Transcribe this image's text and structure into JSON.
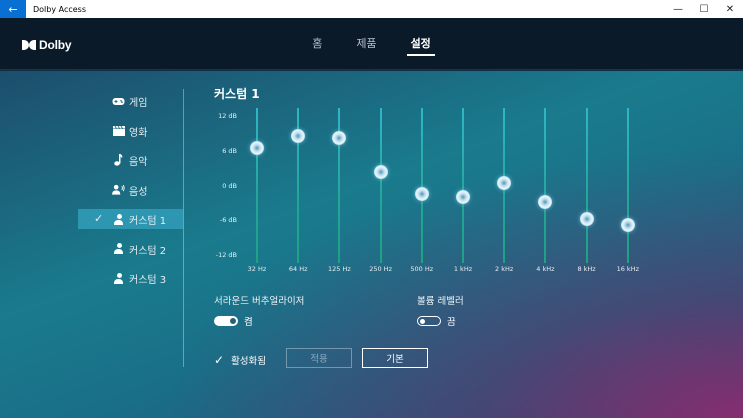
{
  "window": {
    "title": "Dolby Access",
    "back_icon": "←",
    "minimize_icon": "—",
    "maximize_icon": "☐",
    "close_icon": "✕"
  },
  "header": {
    "logo_text": "Dolby",
    "nav": [
      {
        "label": "홈",
        "active": false
      },
      {
        "label": "제품",
        "active": false
      },
      {
        "label": "설정",
        "active": true
      }
    ]
  },
  "sidebar": {
    "items": [
      {
        "label": "게임",
        "icon": "gamepad-icon",
        "active": false
      },
      {
        "label": "영화",
        "icon": "clapperboard-icon",
        "active": false
      },
      {
        "label": "음악",
        "icon": "music-note-icon",
        "active": false
      },
      {
        "label": "음성",
        "icon": "voice-icon",
        "active": false
      },
      {
        "label": "커스텀 1",
        "icon": "person-icon",
        "active": true
      },
      {
        "label": "커스텀 2",
        "icon": "person-icon",
        "active": false
      },
      {
        "label": "커스텀 3",
        "icon": "person-icon",
        "active": false
      }
    ]
  },
  "equalizer": {
    "title": "커스텀 1",
    "db_labels": [
      "12 dB",
      "6 dB",
      "0 dB",
      "-6 dB",
      "-12 dB"
    ],
    "bands": [
      {
        "freq": "32 Hz",
        "gain_db": 6.5
      },
      {
        "freq": "64 Hz",
        "gain_db": 8.6
      },
      {
        "freq": "125 Hz",
        "gain_db": 8.2
      },
      {
        "freq": "250 Hz",
        "gain_db": 2.3
      },
      {
        "freq": "500 Hz",
        "gain_db": -1.5
      },
      {
        "freq": "1 kHz",
        "gain_db": -1.9
      },
      {
        "freq": "2 kHz",
        "gain_db": 0.4
      },
      {
        "freq": "4 kHz",
        "gain_db": -2.8
      },
      {
        "freq": "8 kHz",
        "gain_db": -5.8
      },
      {
        "freq": "16 kHz",
        "gain_db": -6.9
      }
    ]
  },
  "options": {
    "surround": {
      "label": "서라운드 버추얼라이저",
      "state": "켬",
      "on": true
    },
    "volume": {
      "label": "볼륨 레벨러",
      "state": "끔",
      "on": false
    }
  },
  "footer": {
    "enabled_label": "활성화됨",
    "apply_label": "적용",
    "default_label": "기본"
  }
}
